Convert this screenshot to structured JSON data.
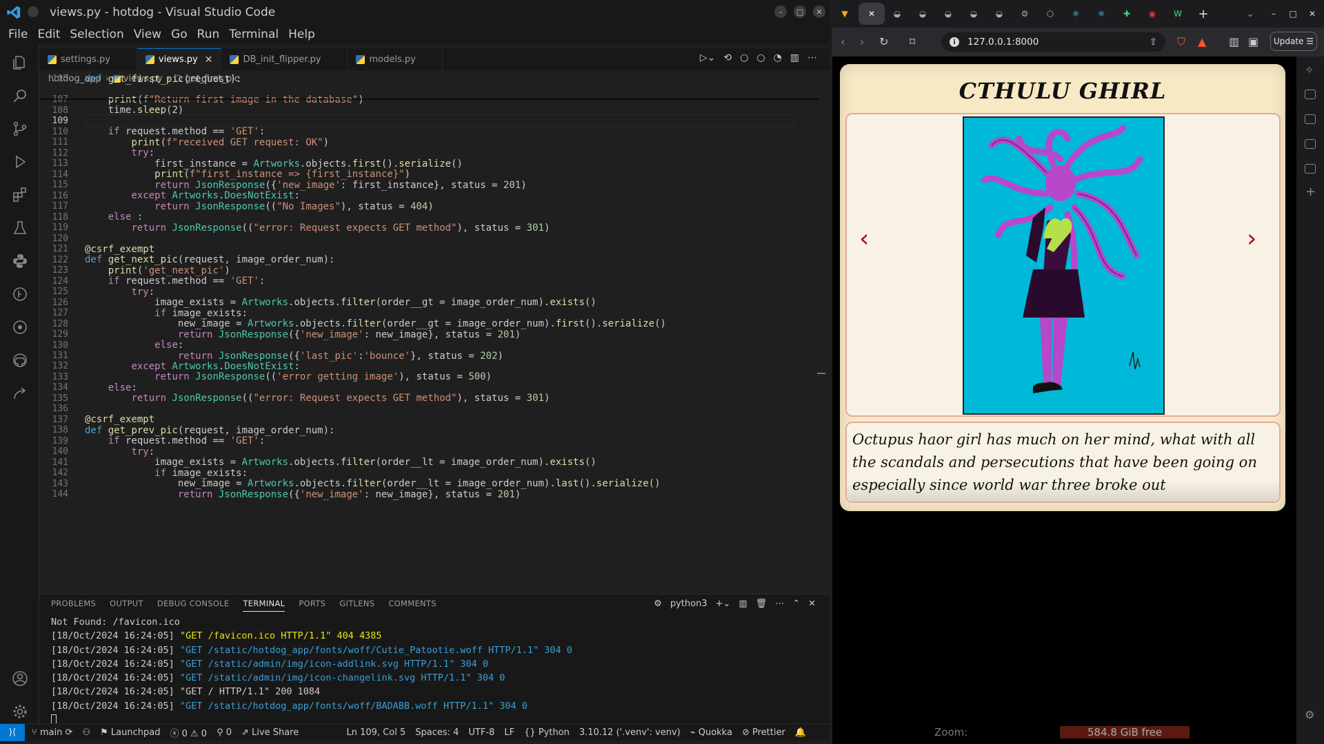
{
  "vscode": {
    "title": "views.py - hotdog - Visual Studio Code",
    "menu": [
      "File",
      "Edit",
      "Selection",
      "View",
      "Go",
      "Run",
      "Terminal",
      "Help"
    ],
    "tabs": [
      {
        "label": "settings.py"
      },
      {
        "label": "views.py"
      },
      {
        "label": "DB_init_flipper.py"
      },
      {
        "label": "models.py"
      }
    ],
    "breadcrumb": [
      "hotdog_app",
      "views.py",
      "get_first_pic"
    ],
    "activity_icons": [
      "explorer-icon",
      "search-icon",
      "source-control-icon",
      "run-debug-icon",
      "extensions-icon",
      "testing-icon",
      "python-icon",
      "gitlens-icon",
      "remote-explorer-icon",
      "github-icon",
      "live-share-icon",
      "account-icon",
      "settings-gear-icon"
    ],
    "code": [
      {
        "n": "105",
        "t": "def get_first_pic(request):"
      },
      {
        "n": "107",
        "t": "    print(f\"Return first image in the database\")"
      },
      {
        "n": "108",
        "t": "    time.sleep(2)"
      },
      {
        "n": "109",
        "t": ""
      },
      {
        "n": "110",
        "t": "    if request.method == 'GET':"
      },
      {
        "n": "111",
        "t": "        print(f\"received GET request: OK\")"
      },
      {
        "n": "112",
        "t": "        try:"
      },
      {
        "n": "113",
        "t": "            first_instance = Artworks.objects.first().serialize()"
      },
      {
        "n": "114",
        "t": "            print(f\"first_instance => {first_instance}\")"
      },
      {
        "n": "115",
        "t": "            return JsonResponse({'new_image': first_instance}, status = 201)"
      },
      {
        "n": "116",
        "t": "        except Artworks.DoesNotExist:"
      },
      {
        "n": "117",
        "t": "            return JsonResponse((\"No Images\"), status = 404)"
      },
      {
        "n": "118",
        "t": "    else :"
      },
      {
        "n": "119",
        "t": "        return JsonResponse((\"error: Request expects GET method\"), status = 301)"
      },
      {
        "n": "120",
        "t": ""
      },
      {
        "n": "121",
        "t": "@csrf_exempt"
      },
      {
        "n": "122",
        "t": "def get_next_pic(request, image_order_num):"
      },
      {
        "n": "123",
        "t": "    print('get_next_pic')"
      },
      {
        "n": "124",
        "t": "    if request.method == 'GET':"
      },
      {
        "n": "125",
        "t": "        try:"
      },
      {
        "n": "126",
        "t": "            image_exists = Artworks.objects.filter(order__gt = image_order_num).exists()"
      },
      {
        "n": "127",
        "t": "            if image_exists:"
      },
      {
        "n": "128",
        "t": "                new_image = Artworks.objects.filter(order__gt = image_order_num).first().serialize()"
      },
      {
        "n": "129",
        "t": "                return JsonResponse({'new_image': new_image}, status = 201)"
      },
      {
        "n": "130",
        "t": "            else:"
      },
      {
        "n": "131",
        "t": "                return JsonResponse({'last_pic':'bounce'}, status = 202)"
      },
      {
        "n": "132",
        "t": "        except Artworks.DoesNotExist:"
      },
      {
        "n": "133",
        "t": "            return JsonResponse(('error getting image'), status = 500)"
      },
      {
        "n": "134",
        "t": "    else:"
      },
      {
        "n": "135",
        "t": "        return JsonResponse((\"error: Request expects GET method\"), status = 301)"
      },
      {
        "n": "136",
        "t": ""
      },
      {
        "n": "137",
        "t": "@csrf_exempt"
      },
      {
        "n": "138",
        "t": "def get_prev_pic(request, image_order_num):"
      },
      {
        "n": "139",
        "t": "    if request.method == 'GET':"
      },
      {
        "n": "140",
        "t": "        try:"
      },
      {
        "n": "141",
        "t": "            image_exists = Artworks.objects.filter(order__lt = image_order_num).exists()"
      },
      {
        "n": "142",
        "t": "            if image_exists:"
      },
      {
        "n": "143",
        "t": "                new_image = Artworks.objects.filter(order__lt = image_order_num).last().serialize()"
      },
      {
        "n": "144",
        "t": "                return JsonResponse({'new_image': new_image}, status = 201)"
      }
    ],
    "current_line": "109",
    "panel": {
      "tabs": [
        "PROBLEMS",
        "OUTPUT",
        "DEBUG CONSOLE",
        "TERMINAL",
        "PORTS",
        "GITLENS",
        "COMMENTS"
      ],
      "active_tab": "TERMINAL",
      "shell": "python3",
      "terminal_lines": [
        {
          "ts": "",
          "req": "Not Found: /favicon.ico",
          "status": "",
          "color": "w"
        },
        {
          "ts": "[18/Oct/2024 16:24:05] ",
          "req": "\"GET /favicon.ico HTTP/1.1\" 404 4385",
          "status": "",
          "color": "y"
        },
        {
          "ts": "[18/Oct/2024 16:24:05] ",
          "req": "\"GET /static/hotdog_app/fonts/woff/Cutie_Patootie.woff HTTP/1.1\" 304 0",
          "status": "",
          "color": "c"
        },
        {
          "ts": "[18/Oct/2024 16:24:05] ",
          "req": "\"GET /static/admin/img/icon-addlink.svg HTTP/1.1\" 304 0",
          "status": "",
          "color": "c"
        },
        {
          "ts": "[18/Oct/2024 16:24:05] ",
          "req": "\"GET /static/admin/img/icon-changelink.svg HTTP/1.1\" 304 0",
          "status": "",
          "color": "c"
        },
        {
          "ts": "[18/Oct/2024 16:24:05] ",
          "req": "\"GET / HTTP/1.1\" 200 1084",
          "status": "",
          "color": "w"
        },
        {
          "ts": "[18/Oct/2024 16:24:05] ",
          "req": "\"GET /static/hotdog_app/fonts/woff/BADABB.woff HTTP/1.1\" 304 0",
          "status": "",
          "color": "c"
        }
      ]
    },
    "status": {
      "branch": "main",
      "launchpad": "Launchpad",
      "problems": "0 ⚠ 0",
      "ports": "0",
      "live_share": "Live Share",
      "position": "Ln 109, Col 5",
      "spaces": "Spaces: 4",
      "encoding": "UTF-8",
      "eol": "LF",
      "language": "Python",
      "interpreter": "3.10.12 ('.venv': venv)",
      "quokka": "Quokka",
      "prettier": "Prettier"
    }
  },
  "browser": {
    "url": "127.0.0.1:8000",
    "update_label": "Update",
    "page": {
      "title": "CTHULU GHIRL",
      "description": "Octupus haor girl has much on her mind, what with all the scandals and persecutions that have been going on especially since world war three broke out",
      "prev_arrow": "‹",
      "next_arrow": "›"
    },
    "bottom_bar": {
      "zoom_label": "Zoom:",
      "disk_free": "584.8 GiB free"
    }
  },
  "colors": {
    "accent": "#0078d4",
    "card_bg": "#f7e9c4",
    "frame_border": "#e8a7a0",
    "arrow": "#b00020",
    "art_bg": "#00b8d8",
    "hair": "#b847c9"
  }
}
